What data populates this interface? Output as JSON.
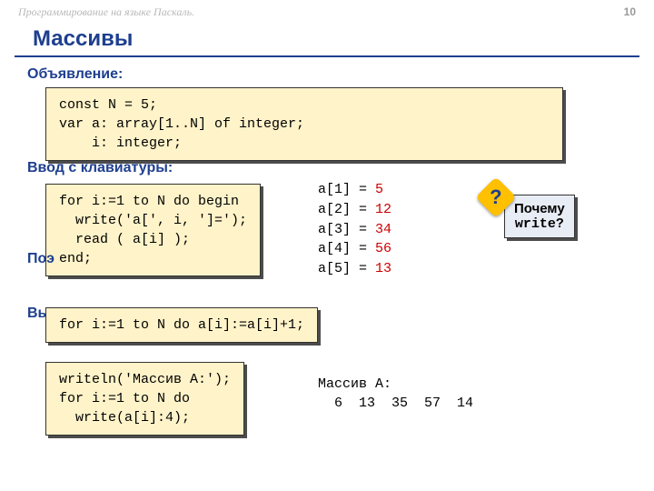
{
  "header": {
    "course": "Программирование на языке Паскаль.",
    "page": "10"
  },
  "title": "Массивы",
  "sections": {
    "declare": "Объявление:",
    "input": "Ввод с клавиатуры:",
    "elemwise": "Поэ",
    "output_label": "Вы"
  },
  "code": {
    "declare": "const N = 5;\nvar a: array[1..N] of integer;\n    i: integer;",
    "input": "for i:=1 to N do begin\n  write('a[', i, ']=');\n  read ( a[i] );\nend;",
    "elemwise": "for i:=1 to N do a[i]:=a[i]+1;",
    "output": "writeln('Массив A:');\nfor i:=1 to N do \n  write(a[i]:4);"
  },
  "array_print": [
    {
      "label": "a[1] =",
      "val": "5"
    },
    {
      "label": "a[2] =",
      "val": "12"
    },
    {
      "label": "a[3] =",
      "val": "34"
    },
    {
      "label": "a[4] =",
      "val": "56"
    },
    {
      "label": "a[5] =",
      "val": "13"
    }
  ],
  "callout": {
    "line1": "Почему",
    "line2": "write?",
    "badge": "?"
  },
  "output_text": "Массив A:\n  6  13  35  57  14"
}
